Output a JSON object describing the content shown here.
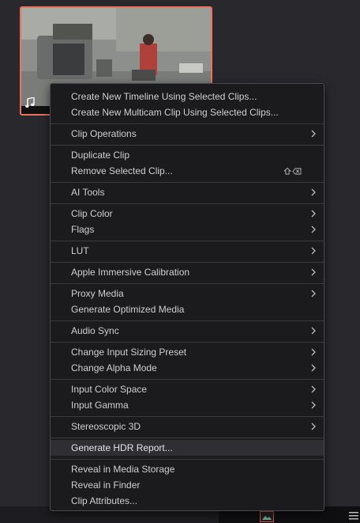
{
  "menu": {
    "items": [
      {
        "label": "Create New Timeline Using Selected Clips...",
        "submenu": false
      },
      {
        "label": "Create New Multicam Clip Using Selected Clips...",
        "submenu": false
      },
      {
        "label": "Clip Operations",
        "submenu": true
      },
      {
        "label": "Duplicate Clip",
        "submenu": false
      },
      {
        "label": "Remove Selected Clip...",
        "submenu": false,
        "shortcut_icon": "shift-delete-icon"
      },
      {
        "label": "AI Tools",
        "submenu": true
      },
      {
        "label": "Clip Color",
        "submenu": true
      },
      {
        "label": "Flags",
        "submenu": true
      },
      {
        "label": "LUT",
        "submenu": true
      },
      {
        "label": "Apple Immersive Calibration",
        "submenu": true
      },
      {
        "label": "Proxy Media",
        "submenu": true
      },
      {
        "label": "Generate Optimized Media",
        "submenu": false
      },
      {
        "label": "Audio Sync",
        "submenu": true
      },
      {
        "label": "Change Input Sizing Preset",
        "submenu": true
      },
      {
        "label": "Change Alpha Mode",
        "submenu": true
      },
      {
        "label": "Input Color Space",
        "submenu": true
      },
      {
        "label": "Input Gamma",
        "submenu": true
      },
      {
        "label": "Stereoscopic 3D",
        "submenu": true
      },
      {
        "label": "Generate HDR Report...",
        "submenu": false,
        "highlighted": true
      },
      {
        "label": "Reveal in Media Storage",
        "submenu": false
      },
      {
        "label": "Reveal in Finder",
        "submenu": false
      },
      {
        "label": "Clip Attributes...",
        "submenu": false
      }
    ]
  },
  "clip": {
    "icon": "music-note-icon",
    "border_color": "#e8735f"
  },
  "colors": {
    "menu_bg": "#1b1b1e",
    "highlight": "#2e2e33",
    "text": "#cfcfd3"
  }
}
